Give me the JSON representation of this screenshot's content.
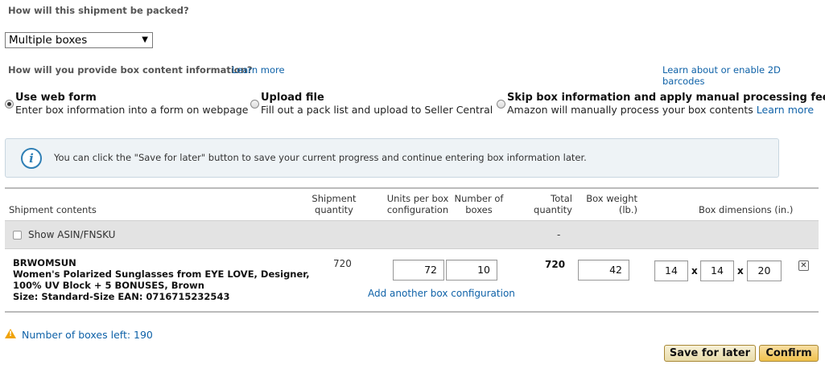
{
  "packing": {
    "question": "How will this shipment be packed?",
    "selected": "Multiple boxes"
  },
  "box_info": {
    "question": "How will you provide box content information?",
    "learn_more": "Learn more",
    "barcodes_link": "Learn about or enable 2D barcodes"
  },
  "options": [
    {
      "title": "Use web form",
      "desc": "Enter box information into a form on webpage",
      "selected": true
    },
    {
      "title": "Upload file",
      "desc": "Fill out a pack list and upload to Seller Central",
      "selected": false
    },
    {
      "title": "Skip box information and apply manual processing fee",
      "desc": "Amazon will manually process your box contents",
      "link": "Learn more",
      "selected": false
    }
  ],
  "info_banner": {
    "icon": "info-icon",
    "text": "You can click the \"Save for later\" button to save your current progress and continue entering box information later."
  },
  "table": {
    "headers": {
      "contents": "Shipment contents",
      "shipment_qty_1": "Shipment",
      "shipment_qty_2": "quantity",
      "units_1": "Units per box",
      "units_2": "configuration",
      "boxes_1": "Number of",
      "boxes_2": "boxes",
      "total_1": "Total",
      "total_2": "quantity",
      "weight_1": "Box weight",
      "weight_2": "(lb.)",
      "dims": "Box dimensions (in.)"
    },
    "show_asin_label": "Show ASIN/FNSKU",
    "summary_total": "-",
    "row": {
      "sku": "BRWOMSUN",
      "name_1": "Women's Polarized Sunglasses from EYE LOVE, Designer,",
      "name_2": "100% UV Block + 5 BONUSES, Brown",
      "size": "Size: Standard-Size EAN: 0716715232543",
      "shipment_qty": "720",
      "units_per_box": "72",
      "num_boxes": "10",
      "total_qty": "720",
      "box_weight": "42",
      "dim_l": "14",
      "dim_w": "14",
      "dim_h": "20",
      "dim_sep": "x",
      "add_config": "Add another box configuration"
    }
  },
  "boxes_left": "Number of boxes left: 190",
  "buttons": {
    "save_later": "Save for later",
    "confirm": "Confirm"
  },
  "colors": {
    "link": "#0f62a8",
    "confirm_bg": "#f0c14b",
    "warning": "#f0a30a"
  }
}
